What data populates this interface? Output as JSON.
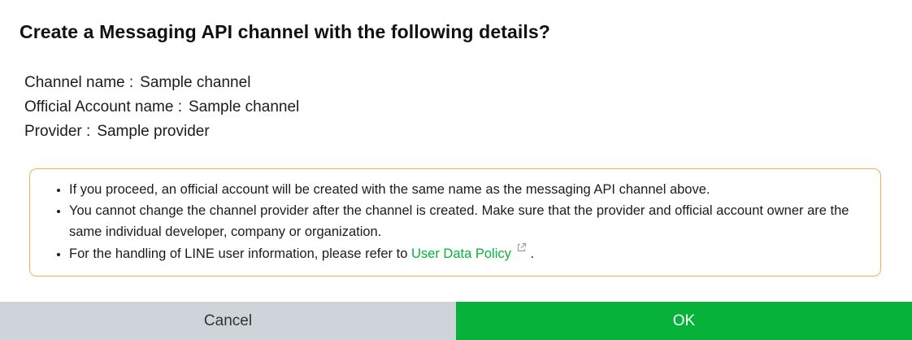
{
  "dialog": {
    "title": "Create a Messaging API channel with the following details?",
    "details": [
      {
        "label": "Channel name :",
        "value": "Sample channel"
      },
      {
        "label": "Official Account name :",
        "value": "Sample channel"
      },
      {
        "label": "Provider :",
        "value": "Sample provider"
      }
    ],
    "notice": {
      "border_color": "#f0b24a",
      "items": [
        "If you proceed, an official account will be created with the same name as the messaging API channel above.",
        "You cannot change the channel provider after the channel is created. Make sure that the provider and official account owner are the same individual developer, company or organization."
      ],
      "policy_prefix": "For the handling of LINE user information, please refer to",
      "policy_link": "User Data Policy",
      "policy_suffix": ".",
      "link_icon": "external-link-icon",
      "link_color": "#06b23a"
    },
    "buttons": {
      "cancel_label": "Cancel",
      "ok_label": "OK",
      "cancel_color": "#cfd3da",
      "ok_color": "#06b23a"
    }
  }
}
